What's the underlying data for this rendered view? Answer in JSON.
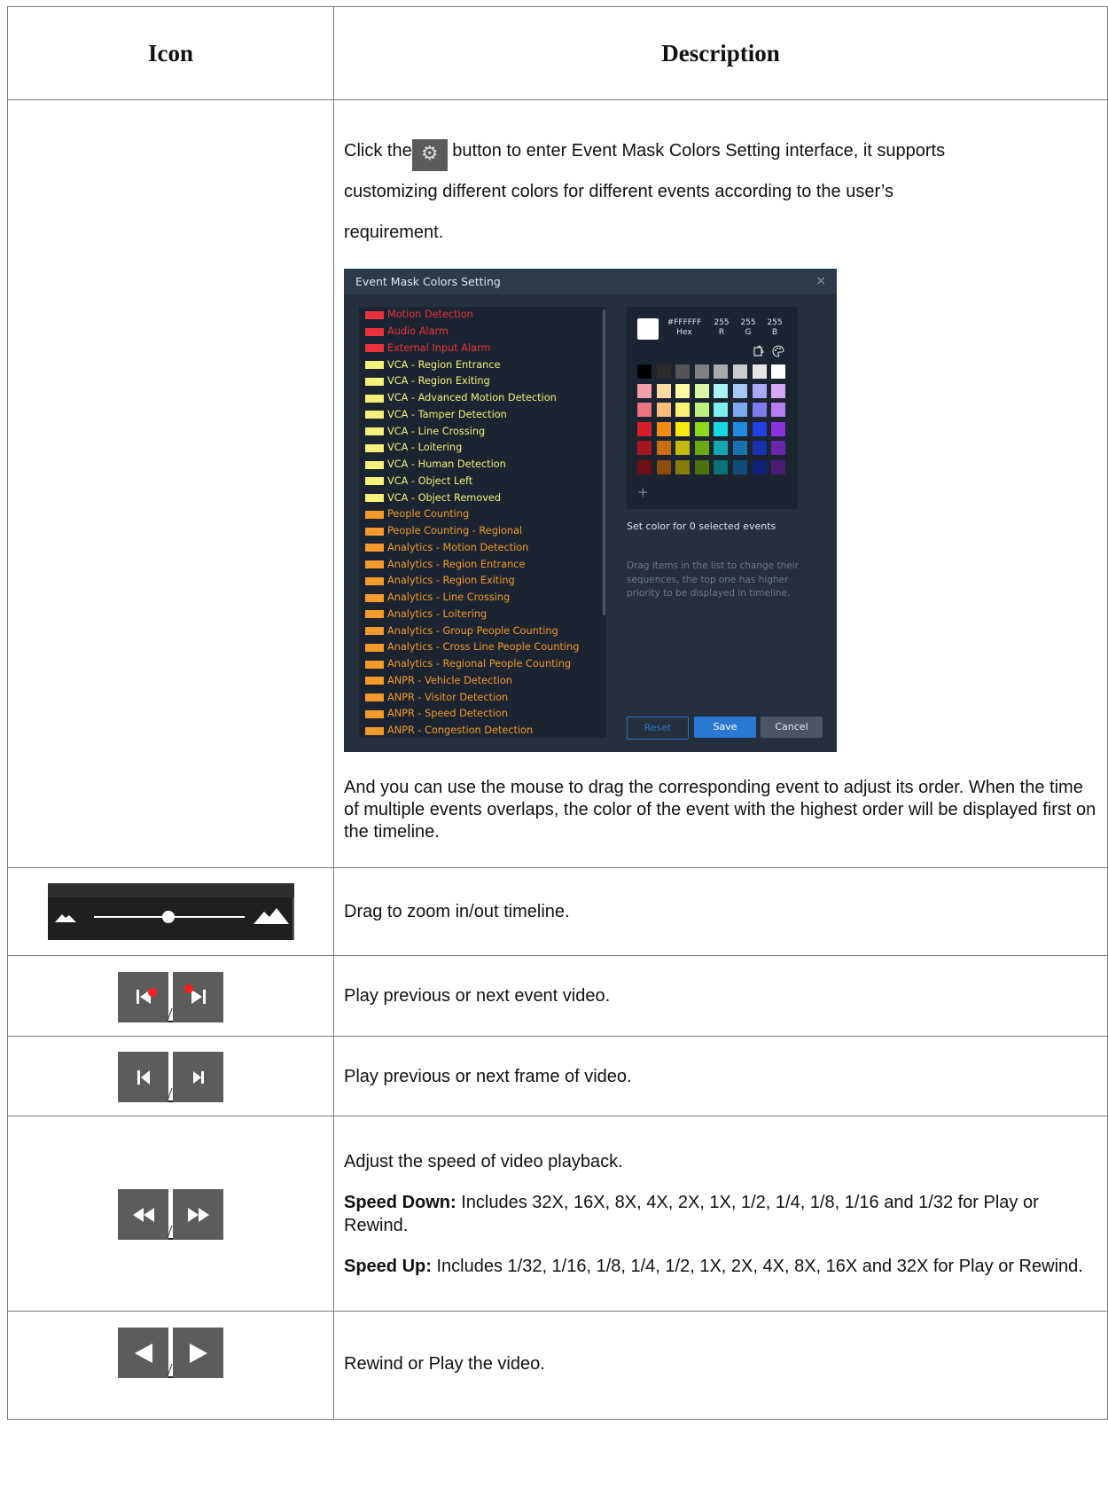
{
  "header": {
    "icon": "Icon",
    "description": "Description"
  },
  "row1": {
    "text_before": "Click the",
    "gear_icon": "gear-icon",
    "text_after": "button to enter Event Mask Colors Setting interface, it supports",
    "line2": "customizing different colors for different events according to the user’s",
    "line3": "requirement.",
    "after_text": "And you can use the mouse to drag the corresponding event to adjust its order. When the time of multiple events overlaps, the color of the event with the highest order will be displayed first on the timeline."
  },
  "dialog": {
    "title": "Event Mask Colors Setting",
    "close": "×",
    "hex_value": "#FFFFFF",
    "hex_label": "Hex",
    "r_value": "255",
    "r_label": "R",
    "g_value": "255",
    "g_label": "G",
    "b_value": "255",
    "b_label": "B",
    "add": "+",
    "set_color_text": "Set color for 0 selected events",
    "hint": "Drag items in the list to change their sequences, the top one has higher priority to be displayed in timeline.",
    "reset": "Reset",
    "save": "Save",
    "cancel": "Cancel",
    "events": [
      {
        "label": "Motion Detection",
        "color": "#e8323c"
      },
      {
        "label": "Audio Alarm",
        "color": "#e8323c"
      },
      {
        "label": "External Input Alarm",
        "color": "#e8323c"
      },
      {
        "label": "VCA - Region Entrance",
        "color": "#f4f17a"
      },
      {
        "label": "VCA - Region Exiting",
        "color": "#f4f17a"
      },
      {
        "label": "VCA - Advanced Motion Detection",
        "color": "#f4f17a"
      },
      {
        "label": "VCA - Tamper Detection",
        "color": "#f4f17a"
      },
      {
        "label": "VCA - Line Crossing",
        "color": "#f4f17a"
      },
      {
        "label": "VCA - Loitering",
        "color": "#f4f17a"
      },
      {
        "label": "VCA - Human Detection",
        "color": "#f4f17a"
      },
      {
        "label": "VCA - Object Left",
        "color": "#f4f17a"
      },
      {
        "label": "VCA - Object Removed",
        "color": "#f4f17a"
      },
      {
        "label": "People Counting",
        "color": "#f39a2b"
      },
      {
        "label": "People Counting - Regional",
        "color": "#f39a2b"
      },
      {
        "label": "Analytics - Motion Detection",
        "color": "#f39a2b"
      },
      {
        "label": "Analytics - Region Entrance",
        "color": "#f39a2b"
      },
      {
        "label": "Analytics - Region Exiting",
        "color": "#f39a2b"
      },
      {
        "label": "Analytics - Line Crossing",
        "color": "#f39a2b"
      },
      {
        "label": "Analytics - Loitering",
        "color": "#f39a2b"
      },
      {
        "label": "Analytics - Group People Counting",
        "color": "#f39a2b"
      },
      {
        "label": "Analytics - Cross Line People Counting",
        "color": "#f39a2b"
      },
      {
        "label": "Analytics - Regional People Counting",
        "color": "#f39a2b"
      },
      {
        "label": "ANPR - Vehicle Detection",
        "color": "#f39a2b"
      },
      {
        "label": "ANPR - Visitor Detection",
        "color": "#f39a2b"
      },
      {
        "label": "ANPR - Speed Detection",
        "color": "#f39a2b"
      },
      {
        "label": "ANPR - Congestion Detection",
        "color": "#f39a2b"
      }
    ],
    "palette": [
      "#000000",
      "#2b2b2b",
      "#555555",
      "#808080",
      "#aaaaaa",
      "#cccccc",
      "#e6e6e6",
      "#ffffff",
      "#f2a1a8",
      "#fcd9a5",
      "#fdf9a5",
      "#d9f6a8",
      "#a8f4f4",
      "#a8c8f4",
      "#a8a8f4",
      "#d4a8f4",
      "#ea7480",
      "#f7be7b",
      "#f9f272",
      "#bdf07c",
      "#7eeeee",
      "#7ca8ee",
      "#7c7cee",
      "#b77cee",
      "#d71f2a",
      "#f28a14",
      "#f9ea0c",
      "#8ad71b",
      "#16d9e0",
      "#1f8ae0",
      "#1f3fe0",
      "#8a33e0",
      "#a61620",
      "#c96e10",
      "#c4b80a",
      "#6ba815",
      "#12a8ad",
      "#1870ad",
      "#1830ad",
      "#6a27ad",
      "#6e0f16",
      "#8c4c0a",
      "#857d07",
      "#4a730e",
      "#0b7377",
      "#104c77",
      "#102177",
      "#4a1b77"
    ]
  },
  "row2": {
    "text": "Drag to zoom in/out timeline."
  },
  "row3": {
    "text": "Play previous or next event video."
  },
  "row4": {
    "text": "Play previous or next frame of video."
  },
  "row5": {
    "line1": "Adjust the speed of video playback.",
    "down_label": "Speed Down:",
    "down_text": " Includes 32X, 16X, 8X, 4X, 2X, 1X, 1/2, 1/4, 1/8, 1/16 and 1/32 for Play or Rewind.",
    "up_label": "Speed Up:",
    "up_text": " Includes 1/32, 1/16, 1/8, 1/4, 1/2, 1X, 2X, 4X, 8X, 16X and 32X for Play or Rewind."
  },
  "row6": {
    "text": "Rewind or Play the video."
  }
}
